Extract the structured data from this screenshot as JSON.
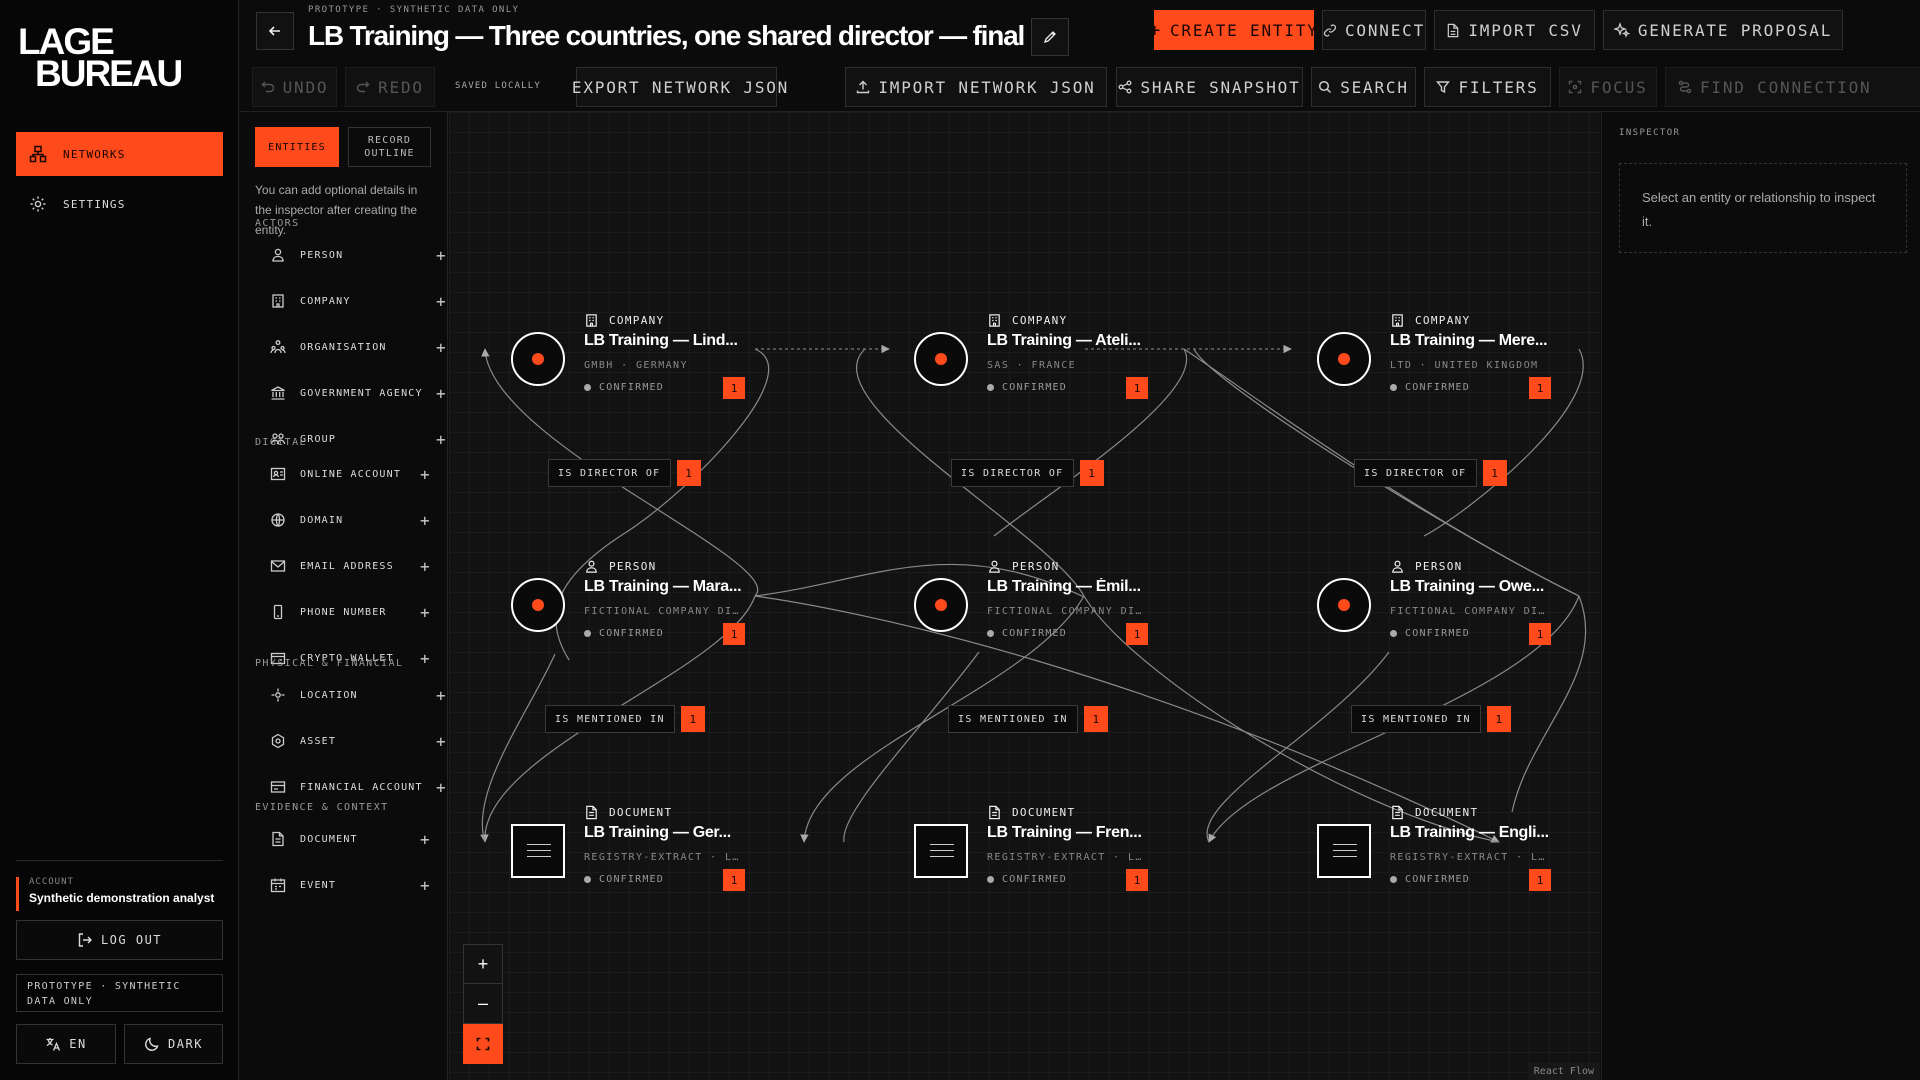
{
  "brand": {
    "line1": "LAGE",
    "line2": "BUREAU"
  },
  "colors": {
    "accent": "#ff4a1c",
    "background": "#0d0d0d"
  },
  "sidebar": {
    "items": [
      {
        "label": "NETWORKS",
        "icon": "network-icon",
        "active": true
      },
      {
        "label": "SETTINGS",
        "icon": "gear-icon",
        "active": false
      }
    ],
    "account_label": "ACCOUNT",
    "account_name": "Synthetic demonstration analyst",
    "logout_label": "LOG OUT",
    "prototype_note": "PROTOTYPE · SYNTHETIC DATA ONLY",
    "language_label": "EN",
    "theme_label": "DARK"
  },
  "header": {
    "prototype_label": "PROTOTYPE · SYNTHETIC DATA ONLY",
    "title": "LB Training — Three countries, one shared director — final",
    "actions": {
      "create": "CREATE ENTITY",
      "connect": "CONNECT",
      "import_csv": "IMPORT CSV",
      "generate": "GENERATE PROPOSAL"
    },
    "toolbar": {
      "undo": "UNDO",
      "redo": "REDO",
      "saved": "SAVED LOCALLY",
      "export_json": "EXPORT NETWORK JSON",
      "import_json": "IMPORT NETWORK JSON",
      "share": "SHARE SNAPSHOT",
      "search": "SEARCH",
      "filters": "FILTERS",
      "focus": "FOCUS",
      "find_connection": "FIND CONNECTION"
    }
  },
  "palette": {
    "tabs": [
      "ENTITIES",
      "RECORD OUTLINE"
    ],
    "helper": "You can add optional details in the inspector after creating the entity.",
    "sections": [
      {
        "title": "ACTORS",
        "items": [
          {
            "label": "PERSON",
            "icon": "person-icon"
          },
          {
            "label": "COMPANY",
            "icon": "building-icon"
          },
          {
            "label": "ORGANISATION",
            "icon": "organisation-icon"
          },
          {
            "label": "GOVERNMENT AGENCY",
            "icon": "government-icon"
          },
          {
            "label": "GROUP",
            "icon": "group-icon"
          }
        ]
      },
      {
        "title": "DIGITAL",
        "items": [
          {
            "label": "ONLINE ACCOUNT",
            "icon": "account-icon"
          },
          {
            "label": "DOMAIN",
            "icon": "globe-icon"
          },
          {
            "label": "EMAIL ADDRESS",
            "icon": "mail-icon"
          },
          {
            "label": "PHONE NUMBER",
            "icon": "phone-icon"
          },
          {
            "label": "CRYPTO WALLET",
            "icon": "wallet-icon"
          }
        ]
      },
      {
        "title": "PHYSICAL & FINANCIAL",
        "items": [
          {
            "label": "LOCATION",
            "icon": "location-icon"
          },
          {
            "label": "ASSET",
            "icon": "asset-icon"
          },
          {
            "label": "FINANCIAL ACCOUNT",
            "icon": "financial-icon"
          }
        ]
      },
      {
        "title": "EVIDENCE & CONTEXT",
        "items": [
          {
            "label": "DOCUMENT",
            "icon": "document-icon"
          },
          {
            "label": "EVENT",
            "icon": "calendar-icon"
          }
        ]
      }
    ]
  },
  "graph": {
    "nodes": [
      {
        "type": "COMPANY",
        "name": "LB Training — Lind...",
        "meta": "GMBH · GERMANY",
        "status": "CONFIRMED",
        "count": "1"
      },
      {
        "type": "COMPANY",
        "name": "LB Training — Ateli...",
        "meta": "SAS · FRANCE",
        "status": "CONFIRMED",
        "count": "1"
      },
      {
        "type": "COMPANY",
        "name": "LB Training — Mere...",
        "meta": "LTD · UNITED KINGDOM",
        "status": "CONFIRMED",
        "count": "1"
      },
      {
        "type": "PERSON",
        "name": "LB Training — Mara...",
        "meta": "FICTIONAL COMPANY DIR...",
        "status": "CONFIRMED",
        "count": "1"
      },
      {
        "type": "PERSON",
        "name": "LB Training — Émil...",
        "meta": "FICTIONAL COMPANY DIR...",
        "status": "CONFIRMED",
        "count": "1"
      },
      {
        "type": "PERSON",
        "name": "LB Training — Owe...",
        "meta": "FICTIONAL COMPANY DIR...",
        "status": "CONFIRMED",
        "count": "1"
      },
      {
        "type": "DOCUMENT",
        "name": "LB Training — Ger...",
        "meta": "REGISTRY-EXTRACT · LA...",
        "status": "CONFIRMED",
        "count": "1"
      },
      {
        "type": "DOCUMENT",
        "name": "LB Training — Fren...",
        "meta": "REGISTRY-EXTRACT · LA...",
        "status": "CONFIRMED",
        "count": "1"
      },
      {
        "type": "DOCUMENT",
        "name": "LB Training — Engli...",
        "meta": "REGISTRY-EXTRACT · LA...",
        "status": "CONFIRMED",
        "count": "1"
      }
    ],
    "edge_labels": [
      {
        "label": "IS DIRECTOR OF",
        "count": "1"
      },
      {
        "label": "IS DIRECTOR OF",
        "count": "1"
      },
      {
        "label": "IS DIRECTOR OF",
        "count": "1"
      },
      {
        "label": "IS MENTIONED IN",
        "count": "1"
      },
      {
        "label": "IS MENTIONED IN",
        "count": "1"
      },
      {
        "label": "IS MENTIONED IN",
        "count": "1"
      }
    ],
    "zoom": {
      "in": "+",
      "out": "–"
    },
    "attribution": "React Flow"
  },
  "inspector": {
    "title": "INSPECTOR",
    "empty": "Select an entity or relationship to inspect it."
  }
}
